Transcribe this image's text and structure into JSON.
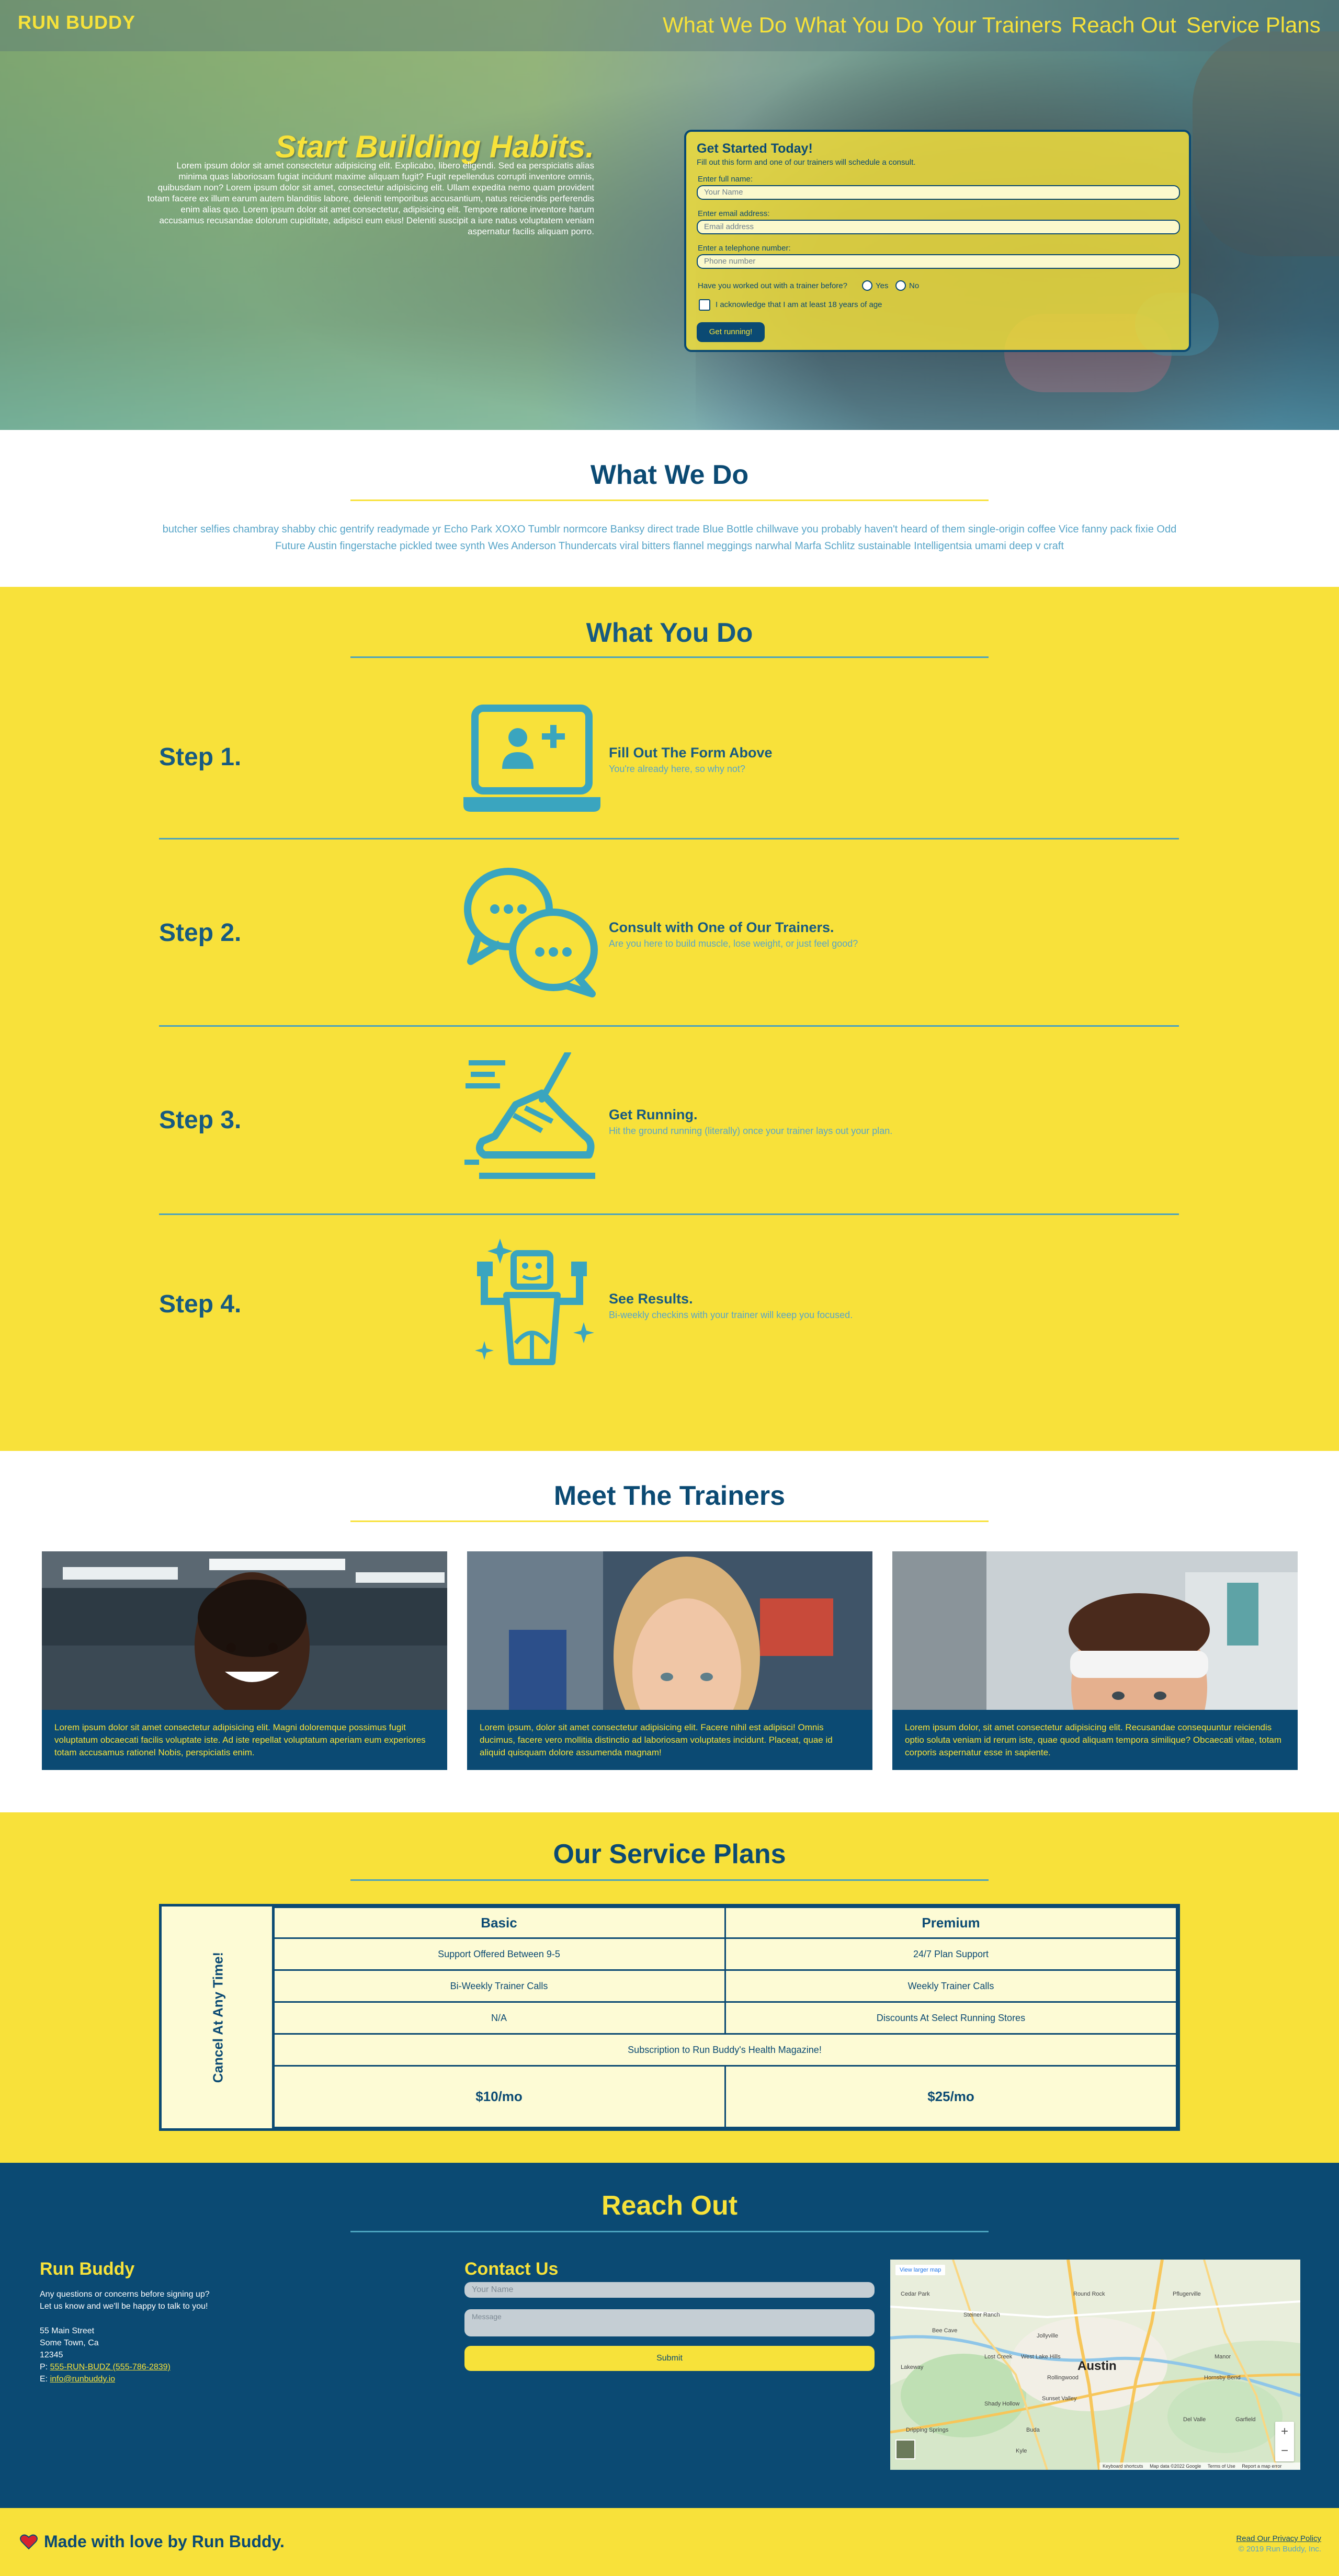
{
  "brand": "RUN BUDDY",
  "nav": [
    "What We Do",
    "What You Do",
    "Your Trainers",
    "Reach Out",
    "Service Plans"
  ],
  "hero": {
    "title": "Start Building Habits.",
    "text": "Lorem ipsum dolor sit amet consectetur adipisicing elit. Explicabo, libero eligendi. Sed ea perspiciatis alias minima quas laboriosam fugiat incidunt maxime aliquam fugit? Fugit repellendus corrupti inventore omnis, quibusdam non? Lorem ipsum dolor sit amet, consectetur adipisicing elit. Ullam expedita nemo quam provident totam facere ex illum earum autem blanditiis labore, deleniti temporibus accusantium, natus reiciendis perferendis enim alias quo. Lorem ipsum dolor sit amet consectetur, adipisicing elit. Tempore ratione inventore harum accusamus recusandae dolorum cupiditate, adipisci eum eius! Deleniti suscipit a iure natus voluptatem veniam aspernatur facilis aliquam porro."
  },
  "form": {
    "title": "Get Started Today!",
    "subtitle": "Fill out this form and one of our trainers will schedule a consult.",
    "name_label": "Enter full name:",
    "name_placeholder": "Your Name",
    "email_label": "Enter email address:",
    "email_placeholder": "Email address",
    "phone_label": "Enter a telephone number:",
    "phone_placeholder": "Phone number",
    "question": "Have you worked out with a trainer before?",
    "yes": "Yes",
    "no": "No",
    "ack": "I acknowledge that I am at least 18 years of age",
    "button": "Get running!"
  },
  "what_we_do": {
    "title": "What We Do",
    "text": "butcher selfies chambray shabby chic gentrify readymade yr Echo Park XOXO Tumblr normcore Banksy direct trade Blue Bottle chillwave you probably haven't heard of them single-origin coffee Vice fanny pack fixie Odd Future Austin fingerstache pickled twee synth Wes Anderson Thundercats viral bitters flannel meggings narwhal Marfa Schlitz sustainable Intelligentsia umami deep v craft"
  },
  "what_you_do": {
    "title": "What You Do",
    "steps": [
      {
        "label": "Step 1.",
        "title": "Fill Out The Form Above",
        "sub": "You're already here, so why not?",
        "icon": "laptop-add-user-icon"
      },
      {
        "label": "Step 2.",
        "title": "Consult with One of Our Trainers.",
        "sub": "Are you here to build muscle, lose weight, or just feel good?",
        "icon": "chat-bubbles-icon"
      },
      {
        "label": "Step 3.",
        "title": "Get Running.",
        "sub": "Hit the ground running (literally) once your trainer lays out your plan.",
        "icon": "running-shoe-icon"
      },
      {
        "label": "Step 4.",
        "title": "See Results.",
        "sub": "Bi-weekly checkins with your trainer will keep you focused.",
        "icon": "strong-robot-icon"
      }
    ]
  },
  "trainers": {
    "title": "Meet The Trainers",
    "items": [
      {
        "text": "Lorem ipsum dolor sit amet consectetur adipisicing elit. Magni doloremque possimus fugit voluptatum obcaecati facilis voluptate iste. Ad iste repellat voluptatum aperiam eum experiores totam accusamus rationel Nobis, perspiciatis enim."
      },
      {
        "text": "Lorem ipsum, dolor sit amet consectetur adipisicing elit. Facere nihil est adipisci! Omnis ducimus, facere vero mollitia distinctio ad laboriosam voluptates incidunt. Placeat, quae id aliquid quisquam dolore assumenda magnam!"
      },
      {
        "text": "Lorem ipsum dolor, sit amet consectetur adipisicing elit. Recusandae consequuntur reiciendis optio soluta veniam id rerum iste, quae quod aliquam tempora similique? Obcaecati vitae, totam corporis aspernatur esse in sapiente."
      }
    ]
  },
  "plans": {
    "title": "Our Service Plans",
    "side_label": "Cancel At Any Time!",
    "headers": [
      "Basic",
      "Premium"
    ],
    "rows": [
      [
        "Support Offered Between 9-5",
        "24/7 Plan Support"
      ],
      [
        "Bi-Weekly Trainer Calls",
        "Weekly Trainer Calls"
      ],
      [
        "N/A",
        "Discounts At Select Running Stores"
      ]
    ],
    "shared_row": "Subscription to Run Buddy's Health Magazine!",
    "prices": [
      "$10/mo",
      "$25/mo"
    ]
  },
  "reach": {
    "title": "Reach Out",
    "company": "Run Buddy",
    "intro1": "Any questions or concerns before signing up?",
    "intro2": "Let us know and we'll be happy to talk to you!",
    "addr1": "55 Main Street",
    "addr2": "Some Town, Ca",
    "addr3": "12345",
    "phone_prefix": "P: ",
    "phone": "555-RUN-BUDZ (555-786-2839)",
    "email_prefix": "E: ",
    "email": "info@runbuddy.io",
    "contact_title": "Contact Us",
    "name_placeholder": "Your Name",
    "message_placeholder": "Message",
    "submit": "Submit",
    "map": {
      "view_larger": "View larger map",
      "city": "Austin",
      "places": [
        "Pflugerville",
        "Round Rock",
        "Cedar Park",
        "Jollyville",
        "Bee Cave",
        "Lakeway",
        "Manor",
        "Del Valle",
        "Buda",
        "Kyle",
        "Hornsby Bend",
        "Garfield",
        "Shady Hollow",
        "Dripping Springs",
        "West Lake Hills",
        "Sunset Valley",
        "Lost Creek",
        "Steiner Ranch",
        "Rollingwood"
      ],
      "attribution": [
        "Keyboard shortcuts",
        "Map data ©2022 Google",
        "Terms of Use",
        "Report a map error"
      ]
    }
  },
  "footer": {
    "made": "Made with love by Run Buddy.",
    "privacy": "Read Our Privacy Policy",
    "copyright": "© 2019 Run Buddy, Inc."
  },
  "colors": {
    "yellow": "#f8e13a",
    "navy": "#0b4a73",
    "teal": "#3aa5bf",
    "cream": "#fdfbd5"
  }
}
